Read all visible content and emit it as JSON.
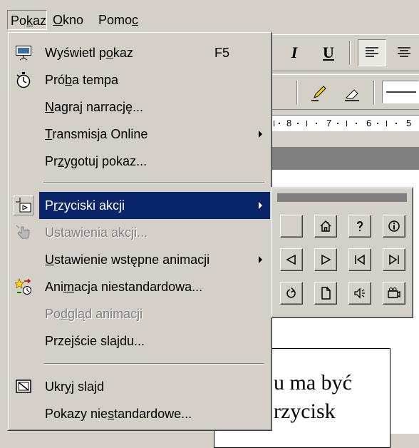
{
  "menubar": {
    "items": [
      {
        "pre": "Po",
        "key": "k",
        "post": "az"
      },
      {
        "pre": "",
        "key": "O",
        "post": "kno"
      },
      {
        "pre": "Pomo",
        "key": "c",
        "post": ""
      }
    ]
  },
  "menu": {
    "items": [
      {
        "pre": "Wyświetl p",
        "key": "o",
        "post": "kaz",
        "shortcut": "F5",
        "icon": "projector-screen-icon"
      },
      {
        "pre": "Pró",
        "key": "b",
        "post": "a tempa",
        "icon": "stopwatch-icon"
      },
      {
        "pre": "",
        "key": "N",
        "post": "agraj narrację..."
      },
      {
        "pre": "",
        "key": "T",
        "post": "ransmisja Online",
        "submenu": true
      },
      {
        "pre": "Pr",
        "key": "z",
        "post": "ygotuj pokaz..."
      },
      {
        "pre": "P",
        "key": "r",
        "post": "zyciski akcji",
        "submenu": true,
        "highlighted": true,
        "icon": "action-button-icon"
      },
      {
        "pre": "Ustawienia akc",
        "key": "j",
        "post": "i...",
        "disabled": true,
        "icon": "hand-pointer-icon"
      },
      {
        "pre": "",
        "key": "U",
        "post": "stawienie wstępne animacji",
        "submenu": true
      },
      {
        "pre": "Ani",
        "key": "m",
        "post": "acja niestandardowa...",
        "icon": "custom-animation-icon"
      },
      {
        "pre": "Po",
        "key": "d",
        "post": "gląd animacji",
        "disabled": true
      },
      {
        "pre": "Przejście sla",
        "key": "j",
        "post": "du..."
      },
      {
        "pre": "Ukr",
        "key": "y",
        "post": "j slajd",
        "icon": "hide-slide-icon"
      },
      {
        "pre": "Pokazy nie",
        "key": "s",
        "post": "tandardowe..."
      }
    ]
  },
  "toolbar": {
    "italic_label": "I",
    "underline_label": "U",
    "icons": [
      "align-left-icon",
      "align-center-icon",
      "pen-icon",
      "eraser-icon",
      "line-style-icon"
    ]
  },
  "ruler": {
    "labels": [
      "8",
      "7",
      "6",
      "5"
    ]
  },
  "slide": {
    "lines": [
      "u ma być",
      "rzycisk"
    ]
  },
  "palette": {
    "buttons": [
      "blank-action-icon",
      "home-icon",
      "help-icon",
      "info-icon",
      "back-icon",
      "forward-icon",
      "beginning-icon",
      "end-icon",
      "return-icon",
      "document-icon",
      "sound-icon",
      "movie-icon"
    ]
  },
  "colors": {
    "menu_bg": "#d4d0c8",
    "highlight": "#0a246a",
    "disabled_text": "#808080",
    "status_bar_gray": "#808080"
  }
}
